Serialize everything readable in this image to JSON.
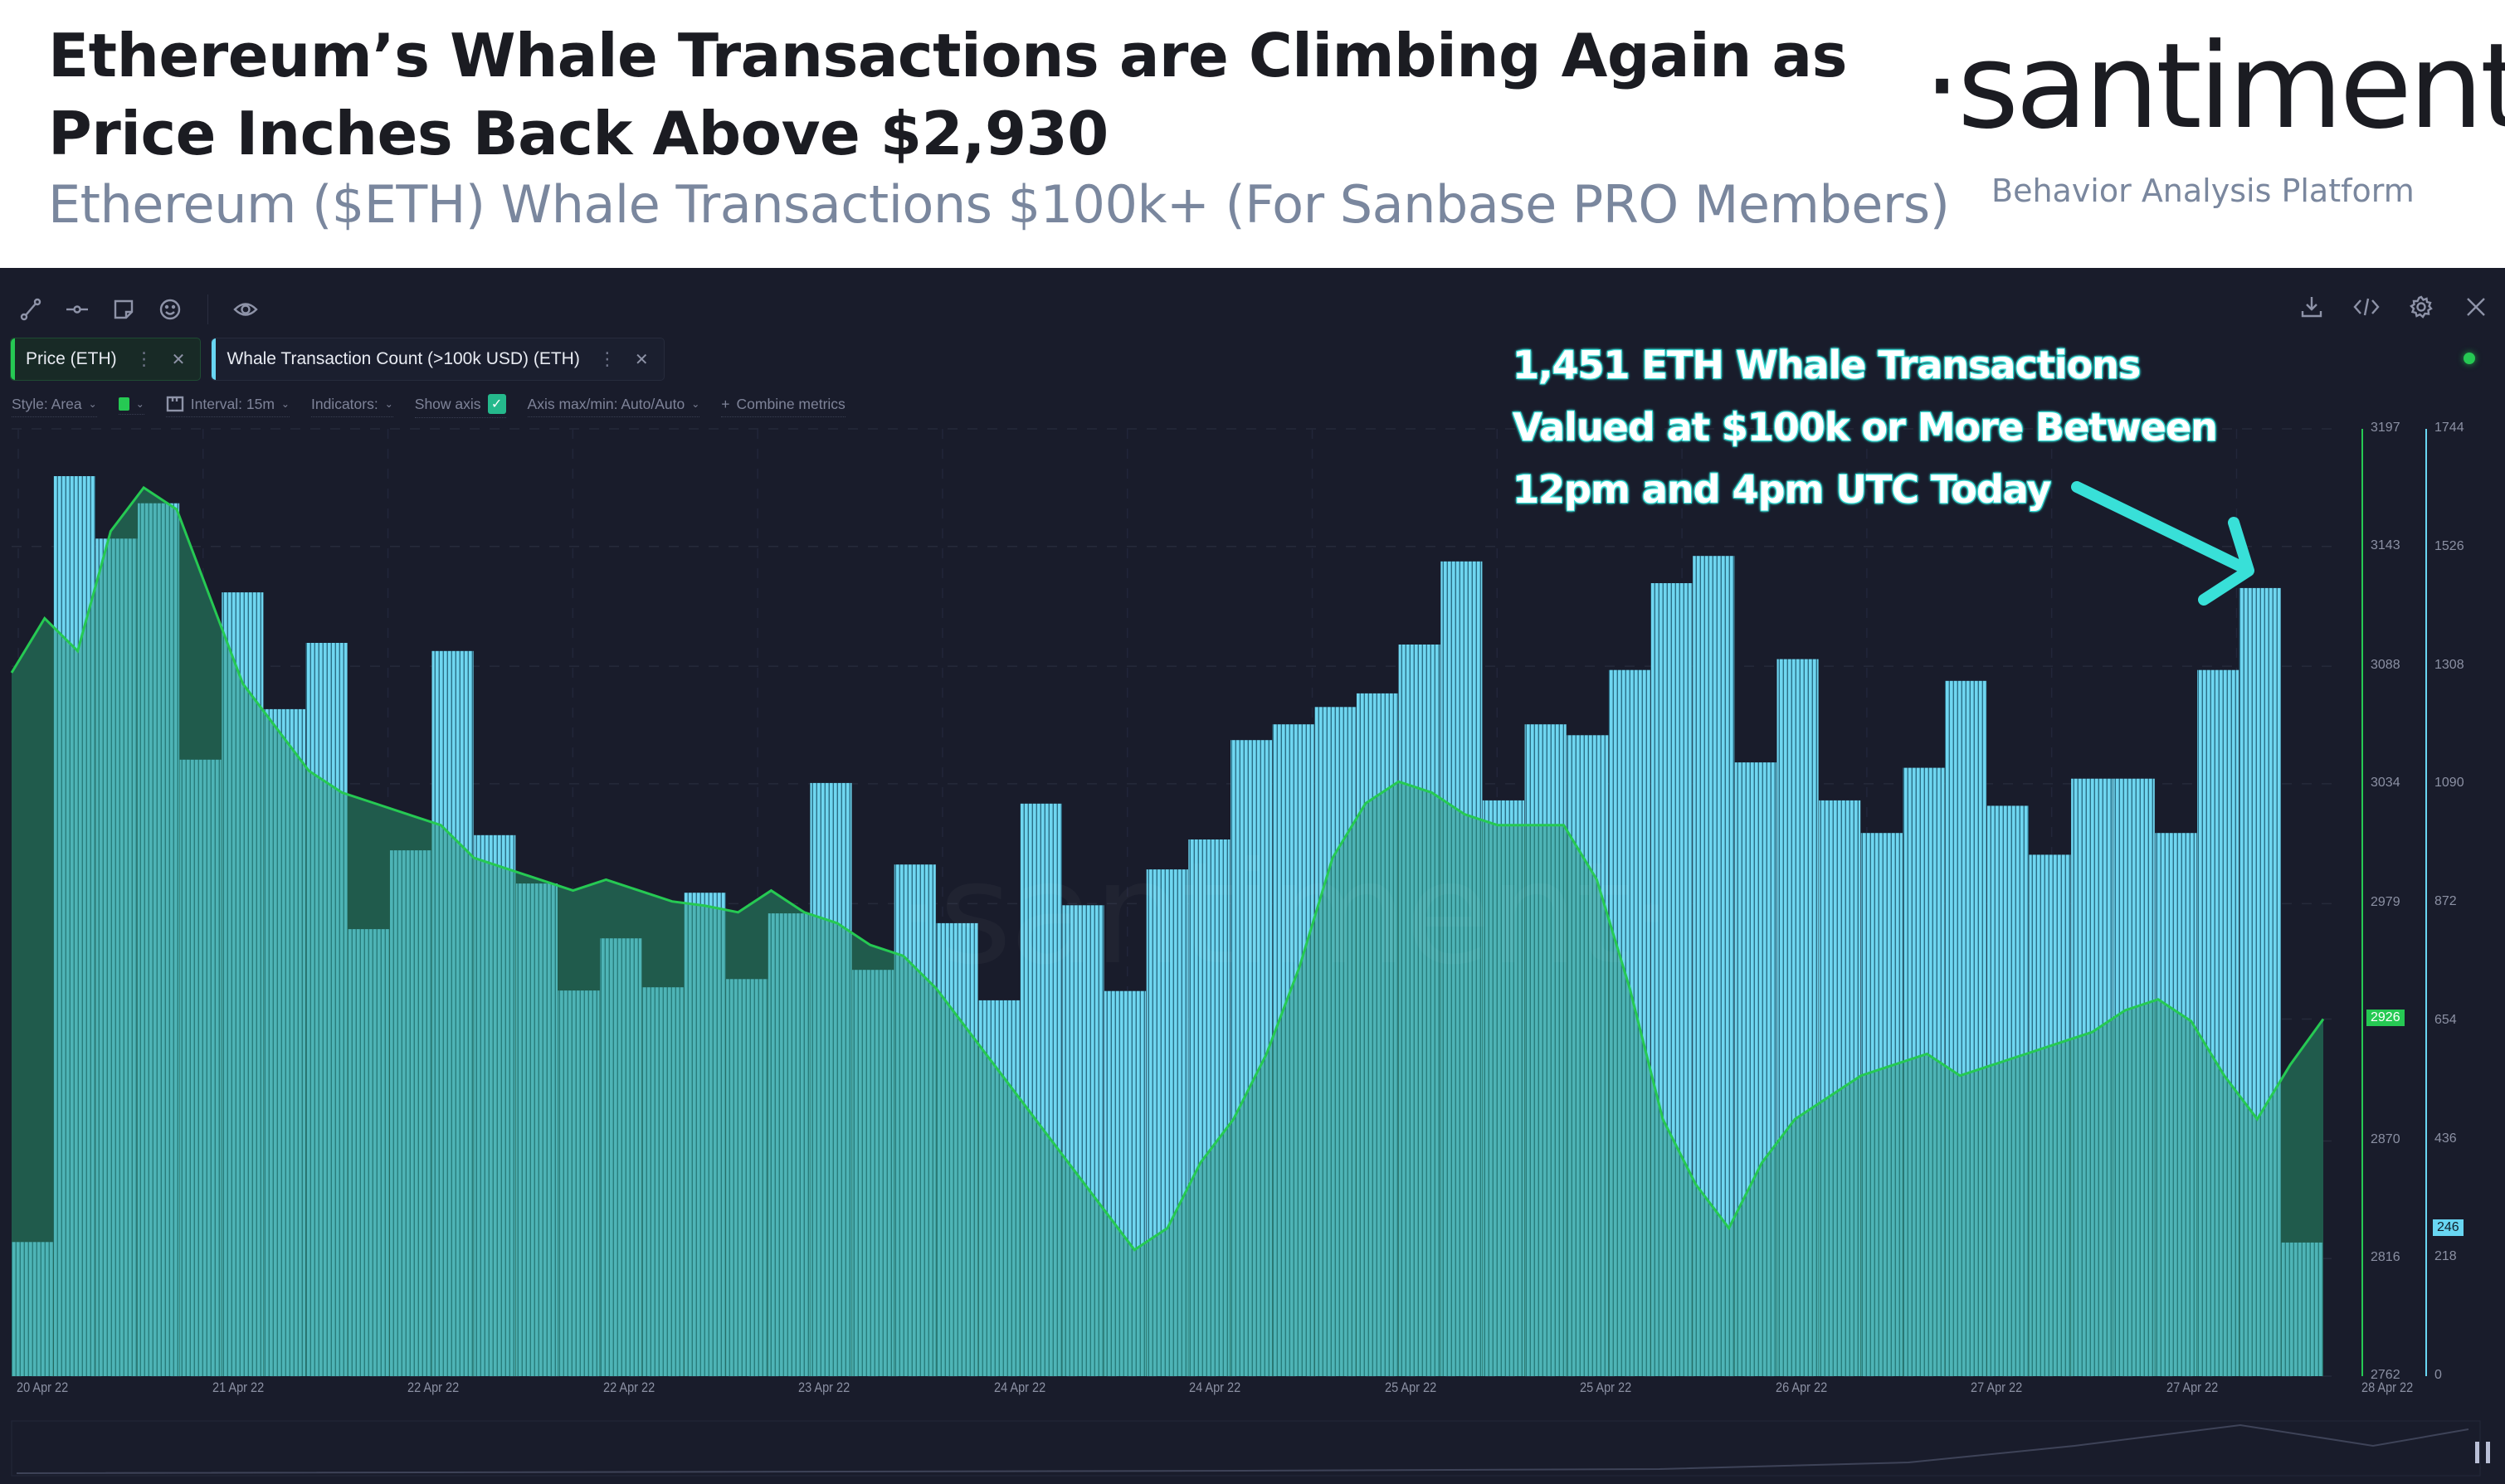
{
  "header": {
    "title_line1": "Ethereum’s Whale Transactions are Climbing Again as",
    "title_line2": "Price Inches Back Above $2,930",
    "subtitle": "Ethereum ($ETH) Whale Transactions $100k+ (For Sanbase PRO Members)",
    "logo": "·santiment·",
    "tagline": "Behavior Analysis Platform"
  },
  "toolbar": {
    "left_icons": [
      "trend-line-icon",
      "horizontal-line-icon",
      "note-icon",
      "emoji-icon",
      "visibility-icon"
    ],
    "right_icons": [
      "download-icon",
      "embed-code-icon",
      "settings-icon",
      "close-icon"
    ]
  },
  "metrics": [
    {
      "label": "Price (ETH)",
      "color": "#26c953"
    },
    {
      "label": "Whale Transaction Count (>100k USD) (ETH)",
      "color": "#68d6f2"
    }
  ],
  "settings": {
    "style": "Style: Area",
    "interval": "Interval: 15m",
    "indicators": "Indicators:",
    "show_axis": "Show axis",
    "show_axis_checked": true,
    "axis_minmax": "Axis max/min: Auto/Auto",
    "combine": "Combine metrics"
  },
  "annotation": {
    "line1": "1,451 ETH Whale Transactions",
    "line2": "Valued at $100k or More Between",
    "line3": "12pm and 4pm UTC Today"
  },
  "watermark": "·santiment·",
  "colors": {
    "price": "#26c953",
    "whale": "#68d6f2",
    "annotation": "#38e0d8",
    "background": "#191c2b"
  },
  "chart_data": {
    "type": "bar",
    "title": "Ethereum ($ETH) Whale Transactions $100k+",
    "x_tick_labels": [
      "20 Apr 22",
      "21 Apr 22",
      "22 Apr 22",
      "22 Apr 22",
      "23 Apr 22",
      "24 Apr 22",
      "24 Apr 22",
      "25 Apr 22",
      "25 Apr 22",
      "26 Apr 22",
      "27 Apr 22",
      "27 Apr 22",
      "28 Apr 22"
    ],
    "price_axis": {
      "ticks": [
        2762,
        2816,
        2870,
        2926,
        2979,
        3034,
        3088,
        3143,
        3197
      ],
      "range": [
        2762,
        3197
      ],
      "current_value": 2926
    },
    "whale_axis": {
      "ticks": [
        0,
        218,
        436,
        654,
        872,
        1090,
        1308,
        1526,
        1744
      ],
      "range": [
        0,
        1744
      ],
      "current_value": 246
    },
    "grid": true,
    "series": [
      {
        "name": "Whale Transaction Count (>100k USD) (ETH)",
        "type": "bar",
        "interval": "4h",
        "values": [
          247,
          1657,
          1542,
          1607,
          1135,
          1443,
          1228,
          1350,
          823,
          968,
          1335,
          996,
          907,
          710,
          806,
          716,
          890,
          731,
          852,
          1092,
          748,
          942,
          834,
          692,
          1054,
          867,
          709,
          933,
          988,
          1171,
          1200,
          1232,
          1257,
          1347,
          1500,
          1060,
          1200,
          1180,
          1300,
          1460,
          1510,
          1130,
          1320,
          1060,
          1000,
          1120,
          1280,
          1050,
          960,
          1100,
          1100,
          1000,
          1300,
          1451,
          246
        ]
      },
      {
        "name": "Price (ETH)",
        "type": "area",
        "values": [
          3085,
          3110,
          3095,
          3150,
          3170,
          3160,
          3120,
          3080,
          3060,
          3040,
          3030,
          3025,
          3020,
          3015,
          3000,
          2995,
          2990,
          2985,
          2990,
          2985,
          2980,
          2978,
          2975,
          2985,
          2975,
          2970,
          2960,
          2955,
          2940,
          2920,
          2900,
          2880,
          2860,
          2840,
          2820,
          2830,
          2860,
          2880,
          2910,
          2950,
          3000,
          3025,
          3035,
          3030,
          3020,
          3015,
          3015,
          3015,
          2990,
          2940,
          2880,
          2850,
          2830,
          2860,
          2880,
          2890,
          2900,
          2905,
          2910,
          2900,
          2905,
          2910,
          2915,
          2920,
          2930,
          2935,
          2925,
          2900,
          2880,
          2905,
          2926
        ]
      }
    ]
  }
}
